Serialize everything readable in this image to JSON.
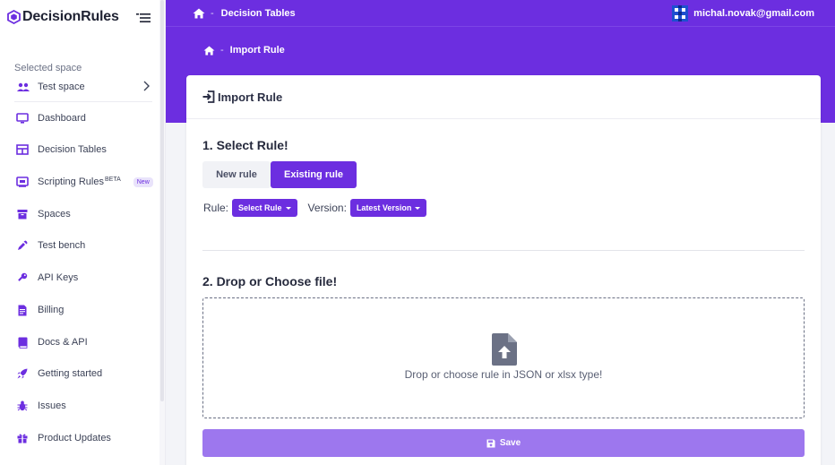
{
  "brand": {
    "name": "DecisionRules",
    "accent": "#6c2ee0",
    "accent_light": "#9d77ee"
  },
  "sidebar": {
    "selected_space_label": "Selected space",
    "space_name": "Test space",
    "items": [
      {
        "label": "Dashboard",
        "icon": "monitor-icon"
      },
      {
        "label": "Decision Tables",
        "icon": "table-icon"
      },
      {
        "label": "Scripting Rules",
        "sup": "BETA",
        "badge": "New",
        "icon": "code-icon"
      },
      {
        "label": "Spaces",
        "icon": "box-icon"
      },
      {
        "label": "Test bench",
        "icon": "eyedropper-icon"
      },
      {
        "label": "API Keys",
        "icon": "key-icon"
      },
      {
        "label": "Billing",
        "icon": "invoice-icon"
      },
      {
        "label": "Docs & API",
        "icon": "book-icon"
      },
      {
        "label": "Getting started",
        "icon": "rocket-icon"
      },
      {
        "label": "Issues",
        "icon": "bug-icon"
      },
      {
        "label": "Product Updates",
        "icon": "gift-icon"
      }
    ]
  },
  "header": {
    "breadcrumb_sep": "-",
    "breadcrumb": "Decision Tables",
    "sub_breadcrumb": "Import Rule",
    "user_email": "michal.novak@gmail.com"
  },
  "card": {
    "title": "Import Rule",
    "step1_title": "1. Select Rule!",
    "tabs": {
      "new_rule": "New rule",
      "existing_rule": "Existing rule"
    },
    "rule_label": "Rule:",
    "rule_select": "Select Rule",
    "version_label": "Version:",
    "version_select": "Latest Version",
    "step2_title": "2. Drop or Choose file!",
    "drop_hint": "Drop or choose rule in JSON or xlsx type!",
    "save_label": "Save"
  }
}
